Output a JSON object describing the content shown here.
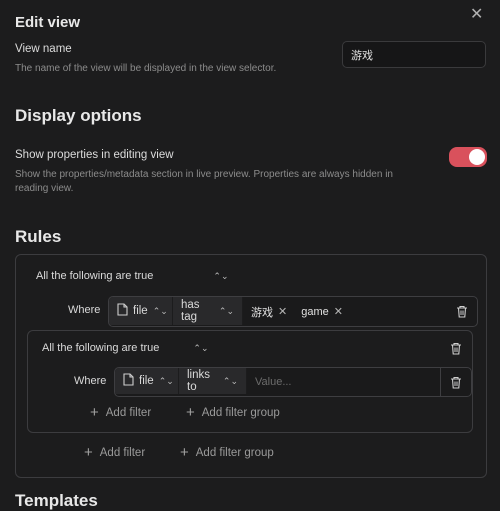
{
  "header": {
    "title": "Edit view"
  },
  "view_name": {
    "label": "View name",
    "description": "The name of the view will be displayed in the view selector.",
    "value": "游戏"
  },
  "display_options": {
    "title": "Display options",
    "toggle_label": "Show properties in editing view",
    "toggle_description": "Show the properties/metadata section in live preview. Properties are always hidden in reading view.",
    "toggle_on": true,
    "toggle_color": "#d9515c"
  },
  "rules": {
    "title": "Rules",
    "outer_group": {
      "conjunction": "All the following are true",
      "filter": {
        "where": "Where",
        "property": "file",
        "operator": "has tag",
        "tags": [
          "游戏",
          "game"
        ]
      },
      "inner_group": {
        "conjunction": "All the following are true",
        "filter": {
          "where": "Where",
          "property": "file",
          "operator": "links to",
          "value_placeholder": "Value..."
        },
        "add_filter": "Add filter",
        "add_filter_group": "Add filter group"
      },
      "add_filter": "Add filter",
      "add_filter_group": "Add filter group"
    }
  },
  "next_section": {
    "title": "Templates"
  }
}
